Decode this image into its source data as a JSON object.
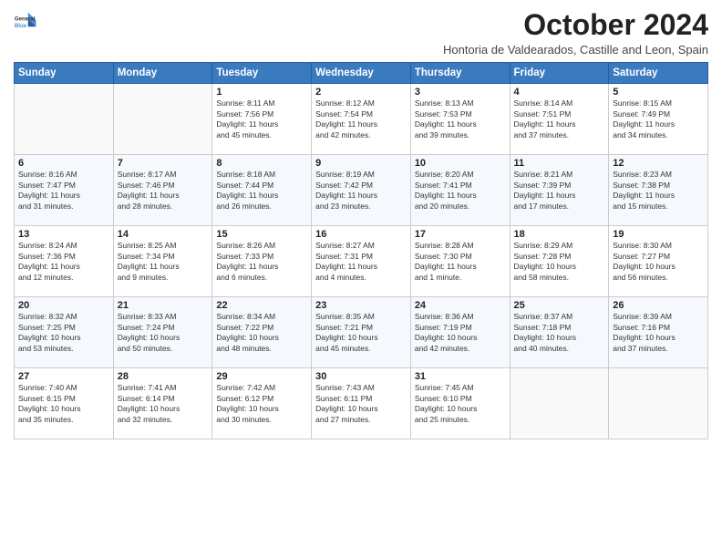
{
  "logo": {
    "line1": "General",
    "line2": "Blue"
  },
  "title": "October 2024",
  "subtitle": "Hontoria de Valdearados, Castille and Leon, Spain",
  "days_of_week": [
    "Sunday",
    "Monday",
    "Tuesday",
    "Wednesday",
    "Thursday",
    "Friday",
    "Saturday"
  ],
  "weeks": [
    [
      {
        "day": "",
        "info": ""
      },
      {
        "day": "",
        "info": ""
      },
      {
        "day": "1",
        "info": "Sunrise: 8:11 AM\nSunset: 7:56 PM\nDaylight: 11 hours\nand 45 minutes."
      },
      {
        "day": "2",
        "info": "Sunrise: 8:12 AM\nSunset: 7:54 PM\nDaylight: 11 hours\nand 42 minutes."
      },
      {
        "day": "3",
        "info": "Sunrise: 8:13 AM\nSunset: 7:53 PM\nDaylight: 11 hours\nand 39 minutes."
      },
      {
        "day": "4",
        "info": "Sunrise: 8:14 AM\nSunset: 7:51 PM\nDaylight: 11 hours\nand 37 minutes."
      },
      {
        "day": "5",
        "info": "Sunrise: 8:15 AM\nSunset: 7:49 PM\nDaylight: 11 hours\nand 34 minutes."
      }
    ],
    [
      {
        "day": "6",
        "info": "Sunrise: 8:16 AM\nSunset: 7:47 PM\nDaylight: 11 hours\nand 31 minutes."
      },
      {
        "day": "7",
        "info": "Sunrise: 8:17 AM\nSunset: 7:46 PM\nDaylight: 11 hours\nand 28 minutes."
      },
      {
        "day": "8",
        "info": "Sunrise: 8:18 AM\nSunset: 7:44 PM\nDaylight: 11 hours\nand 26 minutes."
      },
      {
        "day": "9",
        "info": "Sunrise: 8:19 AM\nSunset: 7:42 PM\nDaylight: 11 hours\nand 23 minutes."
      },
      {
        "day": "10",
        "info": "Sunrise: 8:20 AM\nSunset: 7:41 PM\nDaylight: 11 hours\nand 20 minutes."
      },
      {
        "day": "11",
        "info": "Sunrise: 8:21 AM\nSunset: 7:39 PM\nDaylight: 11 hours\nand 17 minutes."
      },
      {
        "day": "12",
        "info": "Sunrise: 8:23 AM\nSunset: 7:38 PM\nDaylight: 11 hours\nand 15 minutes."
      }
    ],
    [
      {
        "day": "13",
        "info": "Sunrise: 8:24 AM\nSunset: 7:36 PM\nDaylight: 11 hours\nand 12 minutes."
      },
      {
        "day": "14",
        "info": "Sunrise: 8:25 AM\nSunset: 7:34 PM\nDaylight: 11 hours\nand 9 minutes."
      },
      {
        "day": "15",
        "info": "Sunrise: 8:26 AM\nSunset: 7:33 PM\nDaylight: 11 hours\nand 6 minutes."
      },
      {
        "day": "16",
        "info": "Sunrise: 8:27 AM\nSunset: 7:31 PM\nDaylight: 11 hours\nand 4 minutes."
      },
      {
        "day": "17",
        "info": "Sunrise: 8:28 AM\nSunset: 7:30 PM\nDaylight: 11 hours\nand 1 minute."
      },
      {
        "day": "18",
        "info": "Sunrise: 8:29 AM\nSunset: 7:28 PM\nDaylight: 10 hours\nand 58 minutes."
      },
      {
        "day": "19",
        "info": "Sunrise: 8:30 AM\nSunset: 7:27 PM\nDaylight: 10 hours\nand 56 minutes."
      }
    ],
    [
      {
        "day": "20",
        "info": "Sunrise: 8:32 AM\nSunset: 7:25 PM\nDaylight: 10 hours\nand 53 minutes."
      },
      {
        "day": "21",
        "info": "Sunrise: 8:33 AM\nSunset: 7:24 PM\nDaylight: 10 hours\nand 50 minutes."
      },
      {
        "day": "22",
        "info": "Sunrise: 8:34 AM\nSunset: 7:22 PM\nDaylight: 10 hours\nand 48 minutes."
      },
      {
        "day": "23",
        "info": "Sunrise: 8:35 AM\nSunset: 7:21 PM\nDaylight: 10 hours\nand 45 minutes."
      },
      {
        "day": "24",
        "info": "Sunrise: 8:36 AM\nSunset: 7:19 PM\nDaylight: 10 hours\nand 42 minutes."
      },
      {
        "day": "25",
        "info": "Sunrise: 8:37 AM\nSunset: 7:18 PM\nDaylight: 10 hours\nand 40 minutes."
      },
      {
        "day": "26",
        "info": "Sunrise: 8:39 AM\nSunset: 7:16 PM\nDaylight: 10 hours\nand 37 minutes."
      }
    ],
    [
      {
        "day": "27",
        "info": "Sunrise: 7:40 AM\nSunset: 6:15 PM\nDaylight: 10 hours\nand 35 minutes."
      },
      {
        "day": "28",
        "info": "Sunrise: 7:41 AM\nSunset: 6:14 PM\nDaylight: 10 hours\nand 32 minutes."
      },
      {
        "day": "29",
        "info": "Sunrise: 7:42 AM\nSunset: 6:12 PM\nDaylight: 10 hours\nand 30 minutes."
      },
      {
        "day": "30",
        "info": "Sunrise: 7:43 AM\nSunset: 6:11 PM\nDaylight: 10 hours\nand 27 minutes."
      },
      {
        "day": "31",
        "info": "Sunrise: 7:45 AM\nSunset: 6:10 PM\nDaylight: 10 hours\nand 25 minutes."
      },
      {
        "day": "",
        "info": ""
      },
      {
        "day": "",
        "info": ""
      }
    ]
  ]
}
